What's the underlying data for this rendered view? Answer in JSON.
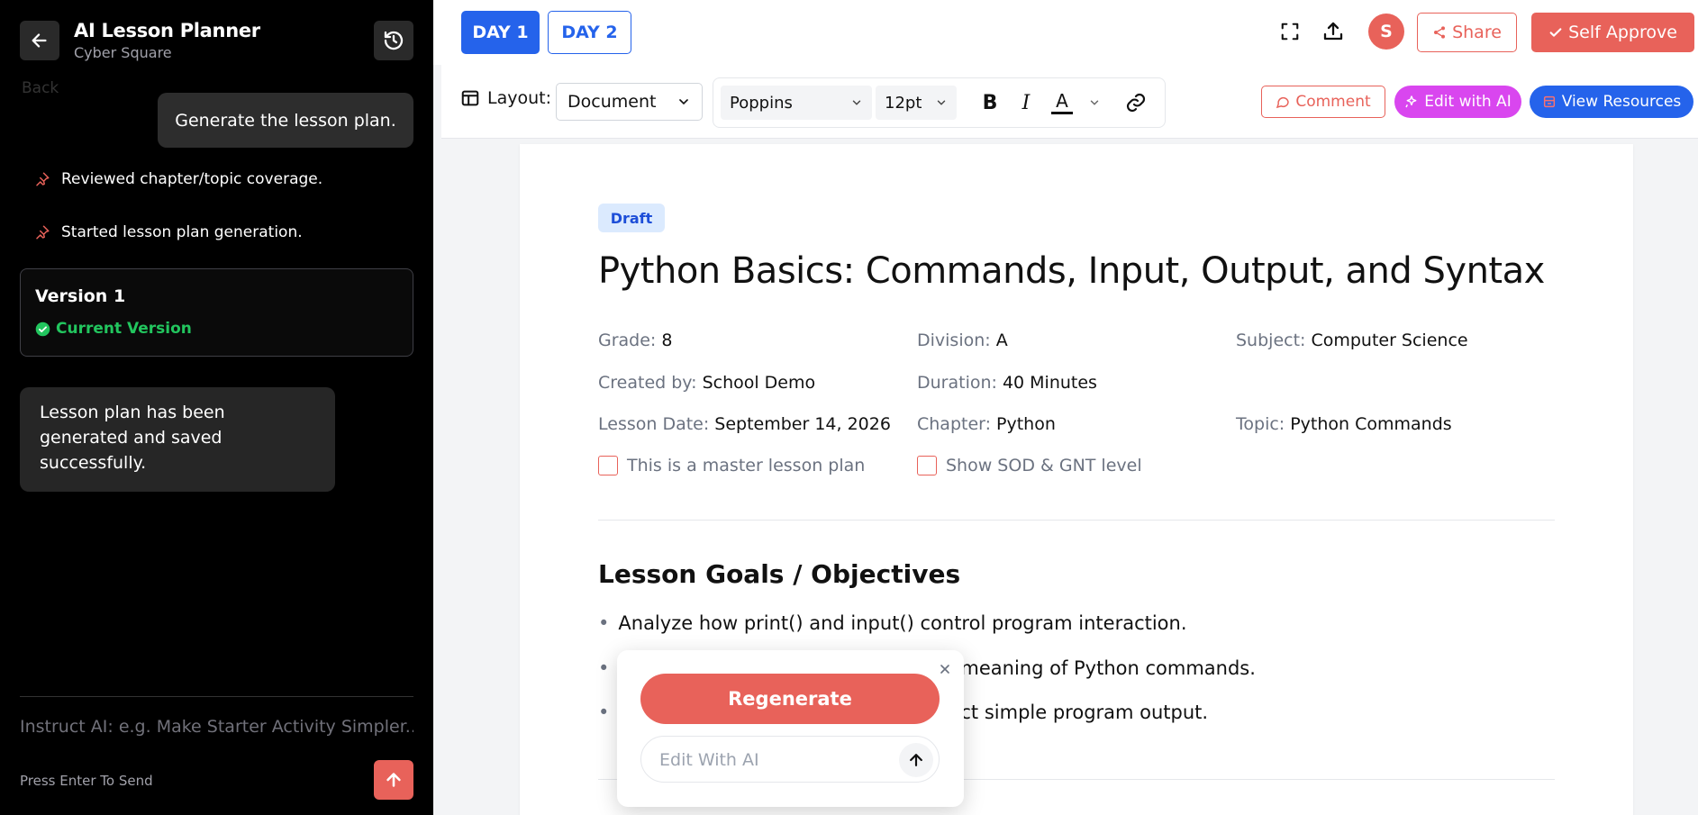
{
  "sidebar": {
    "title": "AI Lesson Planner",
    "subtitle": "Cyber Square",
    "back_label": "Back",
    "user_message": "Generate the lesson plan.",
    "steps": [
      "Reviewed chapter/topic coverage.",
      "Started lesson plan generation."
    ],
    "version": {
      "title": "Version 1",
      "status": "Current Version"
    },
    "ai_message": "Lesson plan has been generated and saved successfully.",
    "instruct_placeholder": "Instruct AI: e.g. Make Starter Activity Simpler...",
    "press_enter": "Press Enter To Send"
  },
  "topbar": {
    "tabs": [
      "DAY 1",
      "DAY 2"
    ],
    "avatar_initial": "S",
    "share_label": "Share",
    "approve_label": "Self Approve"
  },
  "toolbar": {
    "layout_label": "Layout:",
    "layout_value": "Document",
    "font_value": "Poppins",
    "size_value": "12pt",
    "bold": "B",
    "italic": "I",
    "text_color": "A",
    "comment_label": "Comment",
    "edit_ai_label": "Edit with AI",
    "resources_label": "View Resources"
  },
  "document": {
    "badge": "Draft",
    "title": "Python Basics: Commands, Input, Output, and Syntax",
    "meta": {
      "grade_k": "Grade:",
      "grade_v": "8",
      "division_k": "Division:",
      "division_v": "A",
      "subject_k": "Subject:",
      "subject_v": "Computer Science",
      "created_k": "Created by:",
      "created_v": "School Demo",
      "duration_k": "Duration:",
      "duration_v": "40 Minutes",
      "date_k": "Lesson Date:",
      "date_v": "September 14, 2026",
      "chapter_k": "Chapter:",
      "chapter_v": "Python",
      "topic_k": "Topic:",
      "topic_v": "Python Commands"
    },
    "master_checkbox": "This is a master lesson plan",
    "sod_checkbox": "Show SOD & GNT level",
    "section_title": "Lesson Goals / Objectives",
    "goals": [
      "Analyze how print() and input() control program interaction.",
      "meaning of Python commands.",
      "ct simple program output."
    ]
  },
  "popup": {
    "regenerate_label": "Regenerate",
    "edit_placeholder": "Edit With AI"
  },
  "colors": {
    "accent_red": "#e8625a",
    "primary_blue": "#2563eb",
    "magenta": "#d946ef",
    "success_green": "#22c55e"
  }
}
